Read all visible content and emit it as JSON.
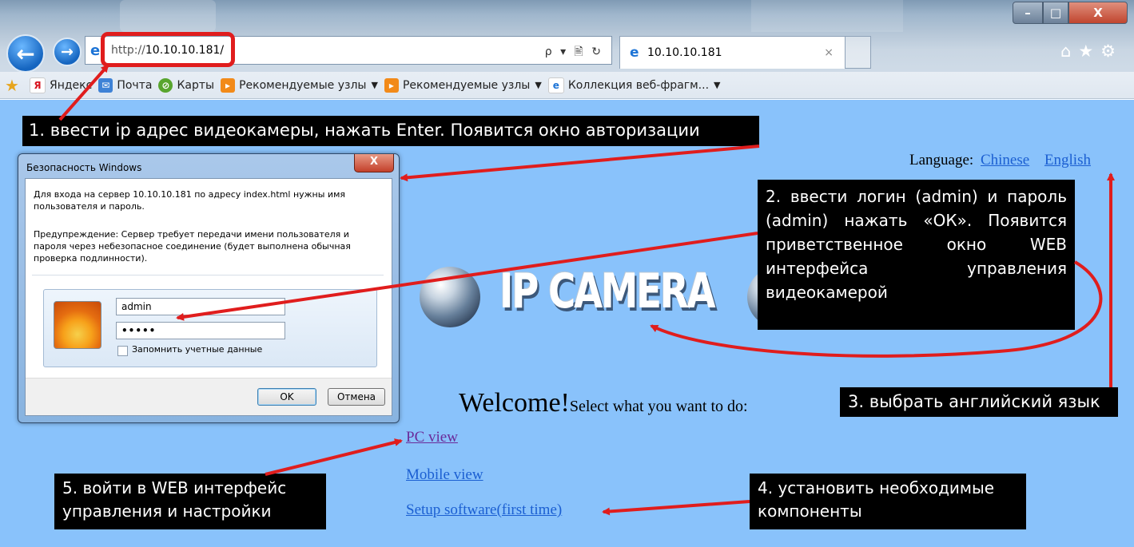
{
  "browser": {
    "address_url_prefix": "http://",
    "address_url_host": "10.10.10.181/",
    "tab_title": "10.10.10.181",
    "tab_close": "×",
    "search_tools": "ρ ▾ 🖹 ↻",
    "right_icons": "⌂★⚙",
    "back_glyph": "←",
    "forward_glyph": "→",
    "win_min": "–",
    "win_max": "□",
    "win_close": "X"
  },
  "favorites": {
    "items": [
      {
        "label": "Яндекс",
        "icon": "yandex-icon"
      },
      {
        "label": "Почта",
        "icon": "mail-icon"
      },
      {
        "label": "Карты",
        "icon": "maps-icon"
      },
      {
        "label": "Рекомендуемые узлы",
        "icon": "recommended-icon"
      },
      {
        "label": "Рекомендуемые узлы",
        "icon": "recommended-icon"
      },
      {
        "label": "Коллекция веб-фрагм...",
        "icon": "ie-icon"
      }
    ]
  },
  "page": {
    "language_label": "Language:",
    "lang_chinese": "Chinese",
    "lang_english": "English",
    "logo_text": "IP CAMERA",
    "welcome_big": "Welcome!",
    "welcome_small": "Select what you want to do:",
    "link_pc": "PC view",
    "link_mobile": "Mobile view",
    "link_setup": "Setup software(first time)"
  },
  "dialog": {
    "title": "Безопасность Windows",
    "close": "X",
    "message": "Для входа на сервер 10.10.10.181 по адресу index.html нужны имя пользователя и пароль.",
    "warning": "Предупреждение: Сервер требует передачи имени пользователя и пароля через небезопасное соединение (будет выполнена обычная проверка подлинности).",
    "username": "admin",
    "password": "•••••",
    "remember": "Запомнить учетные данные",
    "ok": "OK",
    "cancel": "Отмена"
  },
  "annotations": {
    "step1": "1. ввести ip адрес видеокамеры, нажать Enter. Появится окно авторизации",
    "step2": "2. ввести логин (admin) и пароль (admin) нажать «ОК». Появится приветственное окно WEB интерфейса управления видеокамерой",
    "step3": "3. выбрать английский язык",
    "step4": "4. установить необходимые компоненты",
    "step5": "5. войти в WEB интерфейс управления и настройки"
  },
  "colors": {
    "page_bg": "#89c2fb",
    "annotation_bg": "#000000",
    "arrow": "#e01d1d",
    "link": "#1b5fd2",
    "visited_link": "#6a2b9a"
  }
}
